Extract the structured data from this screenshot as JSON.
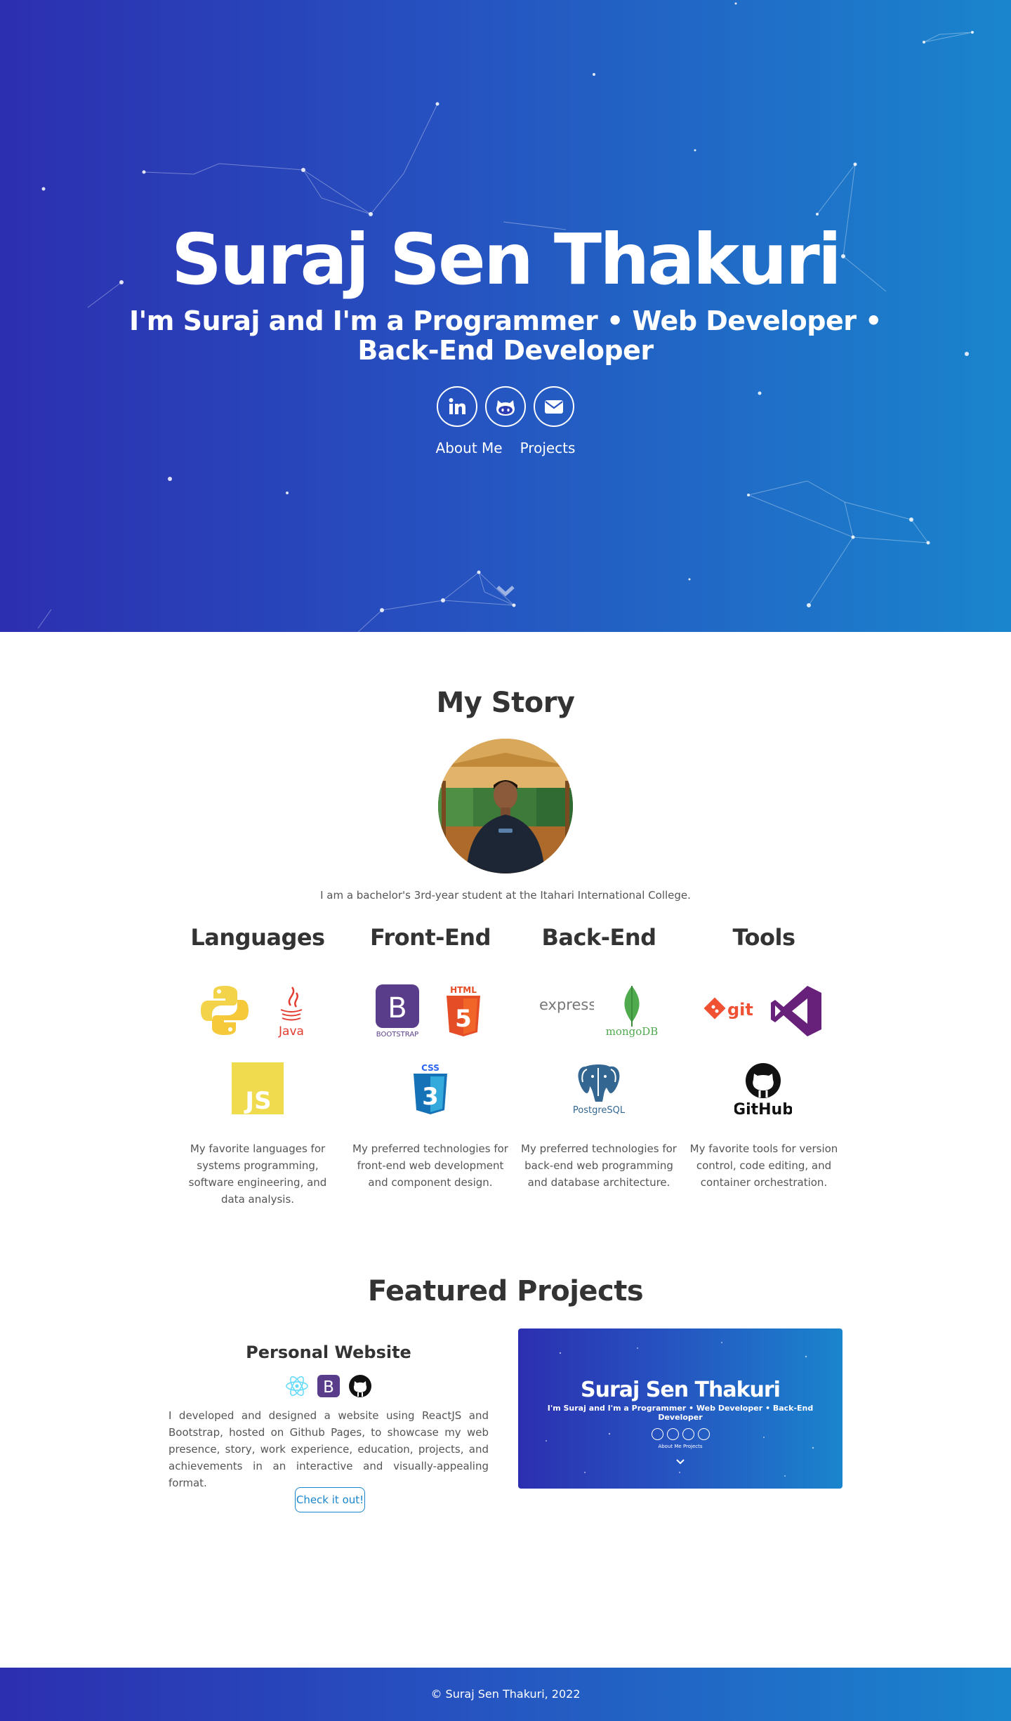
{
  "hero": {
    "name": "Suraj Sen Thakuri",
    "tagline": "I'm Suraj and I'm a Programmer • Web Developer • Back-End Developer",
    "social": [
      "linkedin-icon",
      "github-icon",
      "envelope-icon"
    ],
    "links": {
      "about": "About Me",
      "projects": "Projects"
    },
    "gradient": [
      "#2c2fb0",
      "#1a85cd"
    ]
  },
  "story": {
    "title": "My Story",
    "text": "I am a bachelor's 3rd-year student at the Itahari International College."
  },
  "skills": [
    {
      "title": "Languages",
      "logos": [
        "python-logo",
        "java-logo",
        "javascript-logo"
      ],
      "java_text": "Java",
      "js_text": "JS",
      "desc": "My favorite languages for systems programming, software engineering, and data analysis."
    },
    {
      "title": "Front-End",
      "logos": [
        "bootstrap-logo",
        "html5-logo",
        "css3-logo"
      ],
      "bootstrap_text": "BOOTSTRAP",
      "html_text": "HTML",
      "css_text": "CSS",
      "desc": "My preferred technologies for front-end web development and component design."
    },
    {
      "title": "Back-End",
      "logos": [
        "express-logo",
        "mongodb-logo",
        "postgresql-logo"
      ],
      "express_text": "express",
      "mongo_text": "mongoDB",
      "pg_text": "PostgreSQL",
      "desc": "My preferred technologies for back-end web programming and database architecture."
    },
    {
      "title": "Tools",
      "logos": [
        "git-logo",
        "visual-studio-logo",
        "github-logo"
      ],
      "git_text": "git",
      "github_text": "GitHub",
      "desc": "My favorite tools for version control, code editing, and container orchestration."
    }
  ],
  "projects": {
    "title": "Featured Projects",
    "items": [
      {
        "title": "Personal Website",
        "tech": [
          "react-icon",
          "bootstrap-icon",
          "github-icon"
        ],
        "desc": "I developed and designed a website using ReactJS and Bootstrap, hosted on Github Pages, to showcase my web presence, story, work experience, education, projects, and achievements in an interactive and visually-appealing format.",
        "button": "Check it out!",
        "preview": {
          "title": "Suraj Sen Thakuri",
          "subtitle": "I'm Suraj and I'm a Programmer • Web Developer • Back-End Developer",
          "links": "About Me   Projects"
        }
      }
    ]
  },
  "footer": {
    "text": "© Suraj Sen Thakuri, 2022"
  }
}
